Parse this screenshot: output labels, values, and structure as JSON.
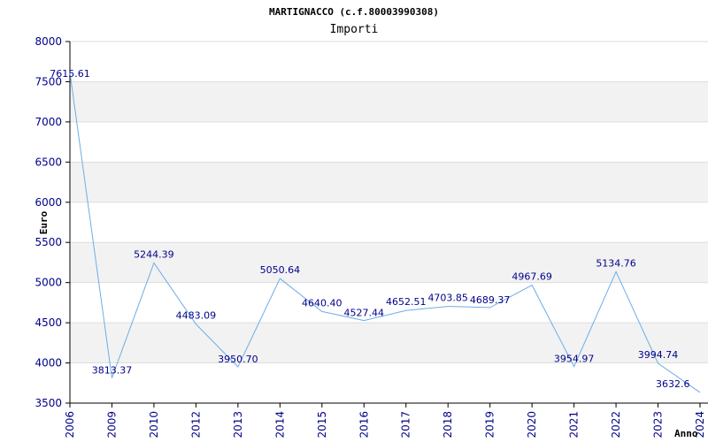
{
  "chart_data": {
    "type": "line",
    "title": "MARTIGNACCO (c.f.80003990308)",
    "subtitle": "Importi",
    "xlabel": "Anno",
    "ylabel": "Euro",
    "categories": [
      "2006",
      "2009",
      "2010",
      "2012",
      "2013",
      "2014",
      "2015",
      "2016",
      "2017",
      "2018",
      "2019",
      "2020",
      "2021",
      "2022",
      "2023",
      "2024"
    ],
    "values": [
      7615.61,
      3813.37,
      5244.39,
      4483.09,
      3950.7,
      5050.64,
      4640.4,
      4527.44,
      4652.51,
      4703.85,
      4689.37,
      4967.69,
      3954.97,
      5134.76,
      3994.74,
      3632.6
    ],
    "value_labels": [
      "7615.61",
      "3813.37",
      "5244.39",
      "4483.09",
      "3950.70",
      "5050.64",
      "4640.40",
      "4527.44",
      "4652.51",
      "4703.85",
      "4689.37",
      "4967.69",
      "3954.97",
      "5134.76",
      "3994.74",
      "3632.6"
    ],
    "ylim": [
      3500,
      8000
    ],
    "yticks": [
      3500,
      4000,
      4500,
      5000,
      5500,
      6000,
      6500,
      7000,
      7500,
      8000
    ],
    "grid": true,
    "colors": {
      "line": "#6aaee8",
      "band": "#f2f2f2",
      "tick_text": "#00008b",
      "label_text": "#00008b",
      "title_text": "#000000"
    }
  }
}
